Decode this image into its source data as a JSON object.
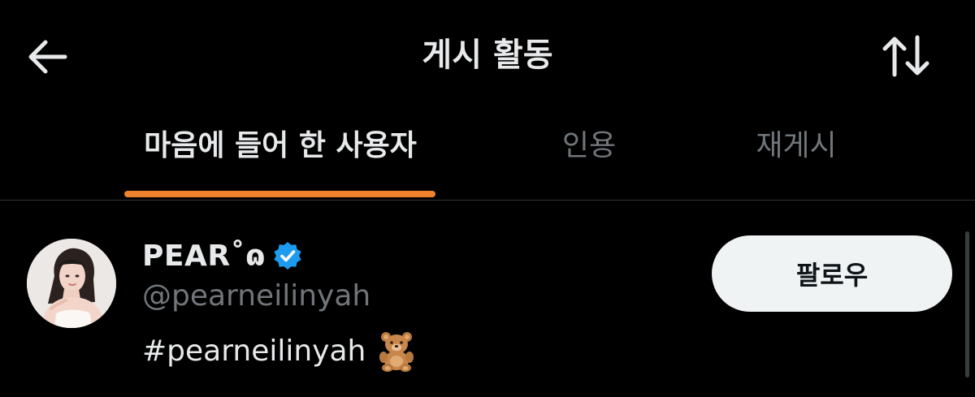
{
  "header": {
    "title": "게시 활동",
    "back_icon": "arrow-left-icon",
    "sort_icon": "sort-arrows-icon"
  },
  "tabs": [
    {
      "label": "마음에 들어 한 사용자",
      "active": true
    },
    {
      "label": "인용",
      "active": false
    },
    {
      "label": "재게시",
      "active": false
    }
  ],
  "users": [
    {
      "display_name": "PEAR˚ɷ",
      "verified": true,
      "handle": "@pearneilinyah",
      "bio": "#pearneilinyah",
      "bio_emoji": "teddy-bear-emoji",
      "follow_label": "팔로우"
    }
  ],
  "colors": {
    "background": "#000000",
    "accent": "#f0822d",
    "primary_text": "#e7e9ea",
    "secondary_text": "#71767b",
    "verified": "#1d9bf0",
    "follow_button_bg": "#eff3f4"
  }
}
